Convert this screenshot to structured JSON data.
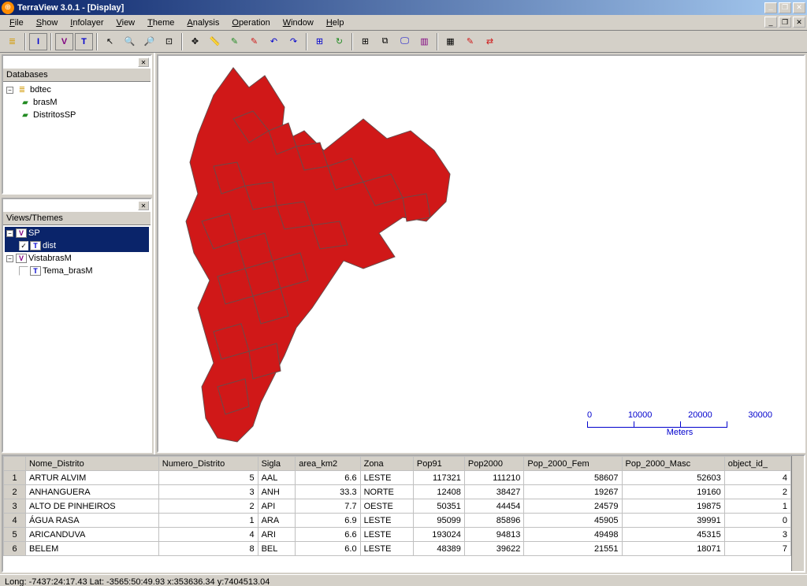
{
  "title": "TerraView 3.0.1 - [Display]",
  "menus": [
    "File",
    "Show",
    "Infolayer",
    "View",
    "Theme",
    "Analysis",
    "Operation",
    "Window",
    "Help"
  ],
  "panels": {
    "databases": "Databases",
    "views": "Views/Themes"
  },
  "db_tree": {
    "root": "bdtec",
    "layers": [
      "brasM",
      "DistritosSP"
    ]
  },
  "views_tree": {
    "v1": "SP",
    "v1_theme": "dist",
    "v1_checked": "✓",
    "v2": "VistabrasM",
    "v2_theme": "Tema_brasM",
    "v2_checked": ""
  },
  "scale": {
    "t0": "0",
    "t1": "10000",
    "t2": "20000",
    "t3": "30000",
    "unit": "Meters"
  },
  "columns": [
    "Nome_Distrito",
    "Numero_Distrito",
    "Sigla",
    "area_km2",
    "Zona",
    "Pop91",
    "Pop2000",
    "Pop_2000_Fem",
    "Pop_2000_Masc",
    "object_id_"
  ],
  "rows": [
    {
      "n": "1",
      "c0": "ARTUR ALVIM",
      "c1": "5",
      "c2": "AAL",
      "c3": "6.6",
      "c4": "LESTE",
      "c5": "117321",
      "c6": "111210",
      "c7": "58607",
      "c8": "52603",
      "c9": "4"
    },
    {
      "n": "2",
      "c0": "ANHANGUERA",
      "c1": "3",
      "c2": "ANH",
      "c3": "33.3",
      "c4": "NORTE",
      "c5": "12408",
      "c6": "38427",
      "c7": "19267",
      "c8": "19160",
      "c9": "2"
    },
    {
      "n": "3",
      "c0": "ALTO DE PINHEIROS",
      "c1": "2",
      "c2": "API",
      "c3": "7.7",
      "c4": "OESTE",
      "c5": "50351",
      "c6": "44454",
      "c7": "24579",
      "c8": "19875",
      "c9": "1"
    },
    {
      "n": "4",
      "c0": "ÁGUA RASA",
      "c1": "1",
      "c2": "ARA",
      "c3": "6.9",
      "c4": "LESTE",
      "c5": "95099",
      "c6": "85896",
      "c7": "45905",
      "c8": "39991",
      "c9": "0"
    },
    {
      "n": "5",
      "c0": "ARICANDUVA",
      "c1": "4",
      "c2": "ARI",
      "c3": "6.6",
      "c4": "LESTE",
      "c5": "193024",
      "c6": "94813",
      "c7": "49498",
      "c8": "45315",
      "c9": "3"
    },
    {
      "n": "6",
      "c0": "BELEM",
      "c1": "8",
      "c2": "BEL",
      "c3": "6.0",
      "c4": "LESTE",
      "c5": "48389",
      "c6": "39622",
      "c7": "21551",
      "c8": "18071",
      "c9": "7"
    }
  ],
  "status": "Long: -7437:24:17.43 Lat: -3565:50:49.93  x:353636.34  y:7404513.04",
  "map_fill": "#d01818",
  "map_stroke": "#6b4a4a"
}
